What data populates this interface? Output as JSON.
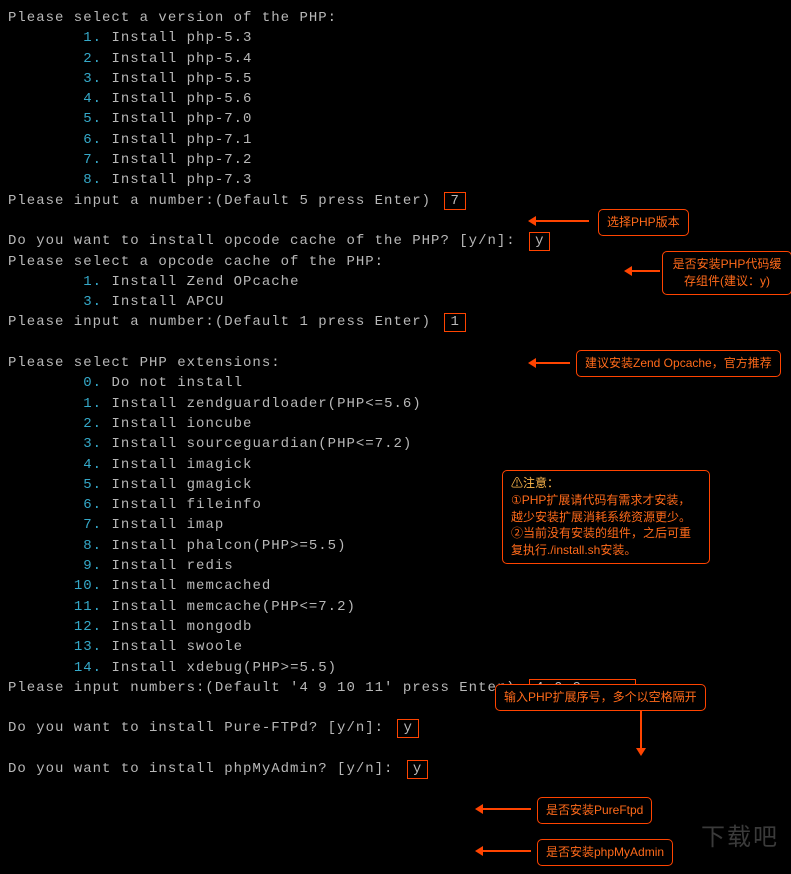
{
  "php_version": {
    "prompt": "Please select a version of the PHP:",
    "options": [
      {
        "n": "1",
        "t": "Install php-5.3"
      },
      {
        "n": "2",
        "t": "Install php-5.4"
      },
      {
        "n": "3",
        "t": "Install php-5.5"
      },
      {
        "n": "4",
        "t": "Install php-5.6"
      },
      {
        "n": "5",
        "t": "Install php-7.0"
      },
      {
        "n": "6",
        "t": "Install php-7.1"
      },
      {
        "n": "7",
        "t": "Install php-7.2"
      },
      {
        "n": "8",
        "t": "Install php-7.3"
      }
    ],
    "input_prompt": "Please input a number:(Default 5 press Enter) ",
    "input_value": "7",
    "annot": "选择PHP版本"
  },
  "opcode_q": {
    "prompt": "Do you want to install opcode cache of the PHP? [y/n]: ",
    "value": "y",
    "annot": "是否安装PHP代码缓存组件(建议：y)"
  },
  "opcode_sel": {
    "prompt": "Please select a opcode cache of the PHP:",
    "options": [
      {
        "n": "1",
        "t": "Install Zend OPcache"
      },
      {
        "n": "3",
        "t": "Install APCU"
      }
    ],
    "input_prompt": "Please input a number:(Default 1 press Enter) ",
    "input_value": "1",
    "annot": "建议安装Zend Opcache，官方推荐"
  },
  "ext": {
    "prompt": "Please select PHP extensions:",
    "options": [
      {
        "n": "0",
        "t": "Do not install"
      },
      {
        "n": "1",
        "t": "Install zendguardloader(PHP<=5.6)"
      },
      {
        "n": "2",
        "t": "Install ioncube"
      },
      {
        "n": "3",
        "t": "Install sourceguardian(PHP<=7.2)"
      },
      {
        "n": "4",
        "t": "Install imagick"
      },
      {
        "n": "5",
        "t": "Install gmagick"
      },
      {
        "n": "6",
        "t": "Install fileinfo"
      },
      {
        "n": "7",
        "t": "Install imap"
      },
      {
        "n": "8",
        "t": "Install phalcon(PHP>=5.5)"
      },
      {
        "n": "9",
        "t": "Install redis"
      },
      {
        "n": "10",
        "t": "Install memcached"
      },
      {
        "n": "11",
        "t": "Install memcache(PHP<=7.2)"
      },
      {
        "n": "12",
        "t": "Install mongodb"
      },
      {
        "n": "13",
        "t": "Install swoole"
      },
      {
        "n": "14",
        "t": "Install xdebug(PHP>=5.5)"
      }
    ],
    "input_prompt": "Please input numbers:(Default '4 9 10 11' press Enter) ",
    "input_value": "4 6 9",
    "annot_title": "输入PHP扩展序号，多个以空格隔开",
    "note_hdr": "⚠注意：",
    "note_l1": "①PHP扩展请代码有需求才安装，越少安装扩展消耗系统资源更少。",
    "note_l2": "②当前没有安装的组件，之后可重复执行./install.sh安装。"
  },
  "pureftpd": {
    "prompt": "Do you want to install Pure-FTPd? [y/n]: ",
    "value": "y",
    "annot": "是否安装PureFtpd"
  },
  "phpmyadmin": {
    "prompt": "Do you want to install phpMyAdmin? [y/n]: ",
    "value": "y",
    "annot": "是否安装phpMyAdmin"
  },
  "watermark": "下载吧"
}
